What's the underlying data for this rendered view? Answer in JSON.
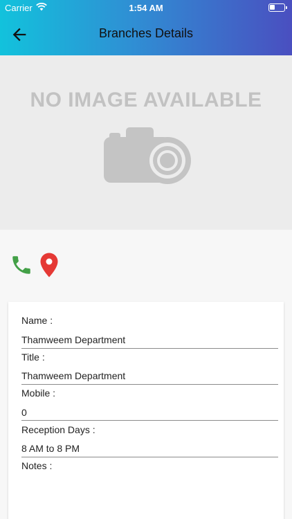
{
  "status_bar": {
    "carrier": "Carrier",
    "time": "1:54 AM"
  },
  "appbar": {
    "title": "Branches Details",
    "back_icon": "arrow-left-icon"
  },
  "hero": {
    "placeholder_text": "NO IMAGE AVAILABLE",
    "icon": "camera-icon"
  },
  "actions": {
    "phone_icon": "phone-icon",
    "location_icon": "map-pin-icon",
    "phone_color": "#43a047",
    "location_color": "#e53935"
  },
  "details": {
    "name_label": "Name :",
    "name_value": "Thamweem Department",
    "title_label": "Title :",
    "title_value": "Thamweem Department",
    "mobile_label": "Mobile :",
    "mobile_value": "0",
    "reception_label": "Reception Days :",
    "reception_value": "8 AM to 8 PM",
    "notes_label": "Notes :"
  },
  "colors": {
    "appbar_gradient_start": "#12c2dc",
    "appbar_gradient_end": "#4a4fc0"
  }
}
